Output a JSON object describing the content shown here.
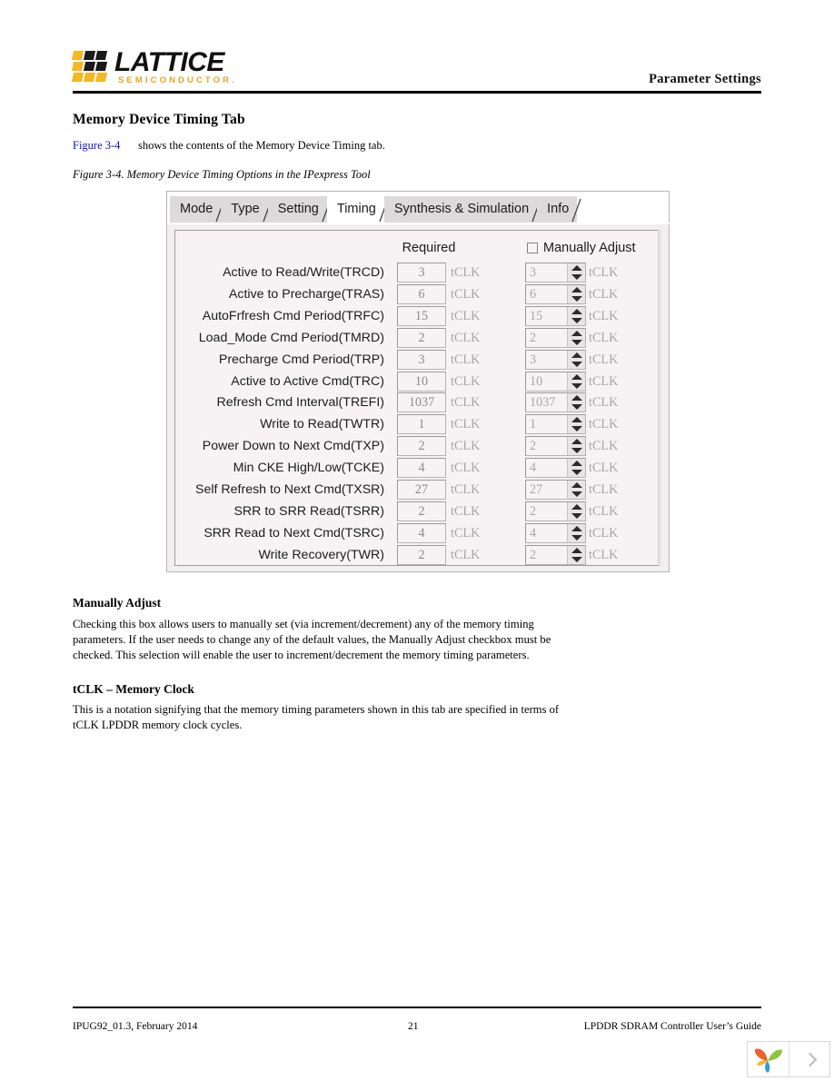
{
  "header": {
    "logo_word": "LATTICE",
    "logo_sub": "SEMICONDUCTOR.",
    "running_head": "Parameter Settings"
  },
  "content": {
    "heading": "Memory Device Timing Tab",
    "figure_ref": "Figure 3-4",
    "figure_ref_sentence": "shows the contents of the Memory Device Timing tab.",
    "figure_caption": "Figure 3-4. Memory Device Timing Options in the IPexpress Tool",
    "section2_heading": "Manually Adjust",
    "section2_body": "Checking this box allows users to manually set (via increment/decrement) any of the memory timing parameters. If the user needs to change any of the default values, the Manually Adjust checkbox must be checked. This selection will enable the user to increment/decrement the memory timing parameters.",
    "section3_heading": "tCLK – Memory Clock",
    "section3_body": "This is a notation signifying that the memory timing parameters shown in this tab are specified in terms of tCLK LPDDR memory clock cycles."
  },
  "dialog": {
    "tabs": [
      {
        "label": "Mode",
        "active": false
      },
      {
        "label": "Type",
        "active": false
      },
      {
        "label": "Setting",
        "active": false
      },
      {
        "label": "Timing",
        "active": true
      },
      {
        "label": "Synthesis & Simulation",
        "active": false
      },
      {
        "label": "Info",
        "active": false
      }
    ],
    "column_headers": {
      "required": "Required",
      "manually_adjust": "Manually Adjust"
    },
    "manually_adjust_checked": false,
    "unit_label": "tCLK",
    "rows": [
      {
        "label": "Active to Read/Write(TRCD)",
        "required": "3",
        "adjust": "3"
      },
      {
        "label": "Active to Precharge(TRAS)",
        "required": "6",
        "adjust": "6"
      },
      {
        "label": "AutoFrfresh Cmd Period(TRFC)",
        "required": "15",
        "adjust": "15"
      },
      {
        "label": "Load_Mode Cmd Period(TMRD)",
        "required": "2",
        "adjust": "2"
      },
      {
        "label": "Precharge Cmd Period(TRP)",
        "required": "3",
        "adjust": "3"
      },
      {
        "label": "Active to Active Cmd(TRC)",
        "required": "10",
        "adjust": "10"
      },
      {
        "label": "Refresh Cmd Interval(TREFI)",
        "required": "1037",
        "adjust": "1037"
      },
      {
        "label": "Write to Read(TWTR)",
        "required": "1",
        "adjust": "1"
      },
      {
        "label": "Power Down to Next Cmd(TXP)",
        "required": "2",
        "adjust": "2"
      },
      {
        "label": "Min CKE High/Low(TCKE)",
        "required": "4",
        "adjust": "4"
      },
      {
        "label": "Self Refresh to Next Cmd(TXSR)",
        "required": "27",
        "adjust": "27"
      },
      {
        "label": "SRR to SRR Read(TSRR)",
        "required": "2",
        "adjust": "2"
      },
      {
        "label": "SRR Read to Next Cmd(TSRC)",
        "required": "4",
        "adjust": "4"
      },
      {
        "label": "Write Recovery(TWR)",
        "required": "2",
        "adjust": "2"
      }
    ]
  },
  "footer": {
    "left": "IPUG92_01.3, February 2014",
    "center": "21",
    "right": "LPDDR SDRAM Controller User’s Guide"
  },
  "colors": {
    "logo_yellow": "#F5B722",
    "logo_black": "#1A1A1A",
    "link_blue": "#1010D0",
    "dialog_bg": "#F1EFF0",
    "panel_bg": "#F7F3F5"
  }
}
